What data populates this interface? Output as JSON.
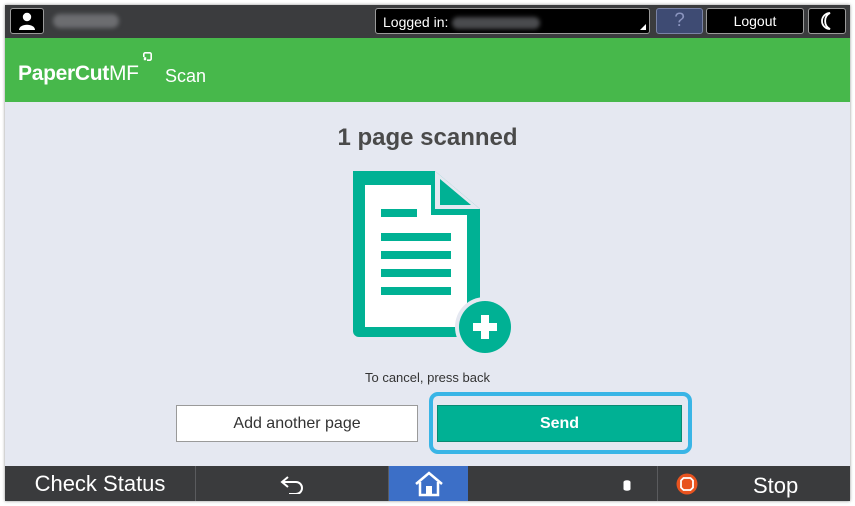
{
  "topbar": {
    "logged_in_label": "Logged in:",
    "help_label": "?",
    "logout_label": "Logout"
  },
  "header": {
    "brand_main": "PaperCut",
    "brand_suffix": "MF",
    "section_title": "Scan"
  },
  "scan": {
    "status_text": "1 page scanned",
    "cancel_hint": "To cancel, press back",
    "add_page_label": "Add another page",
    "send_label": "Send"
  },
  "bottombar": {
    "check_status_label": "Check Status",
    "stop_label": "Stop"
  },
  "icons": {
    "user": "user-icon",
    "moon": "moon-icon",
    "document": "document-add-icon",
    "back": "back-arrow-icon",
    "home": "home-icon",
    "toner": "toner-icon",
    "stop": "stop-icon"
  },
  "colors": {
    "header_green": "#47b84b",
    "accent_teal": "#00b194",
    "focus_ring": "#39b5e6",
    "home_blue": "#3c6fc7",
    "stop_orange": "#e8531f"
  }
}
